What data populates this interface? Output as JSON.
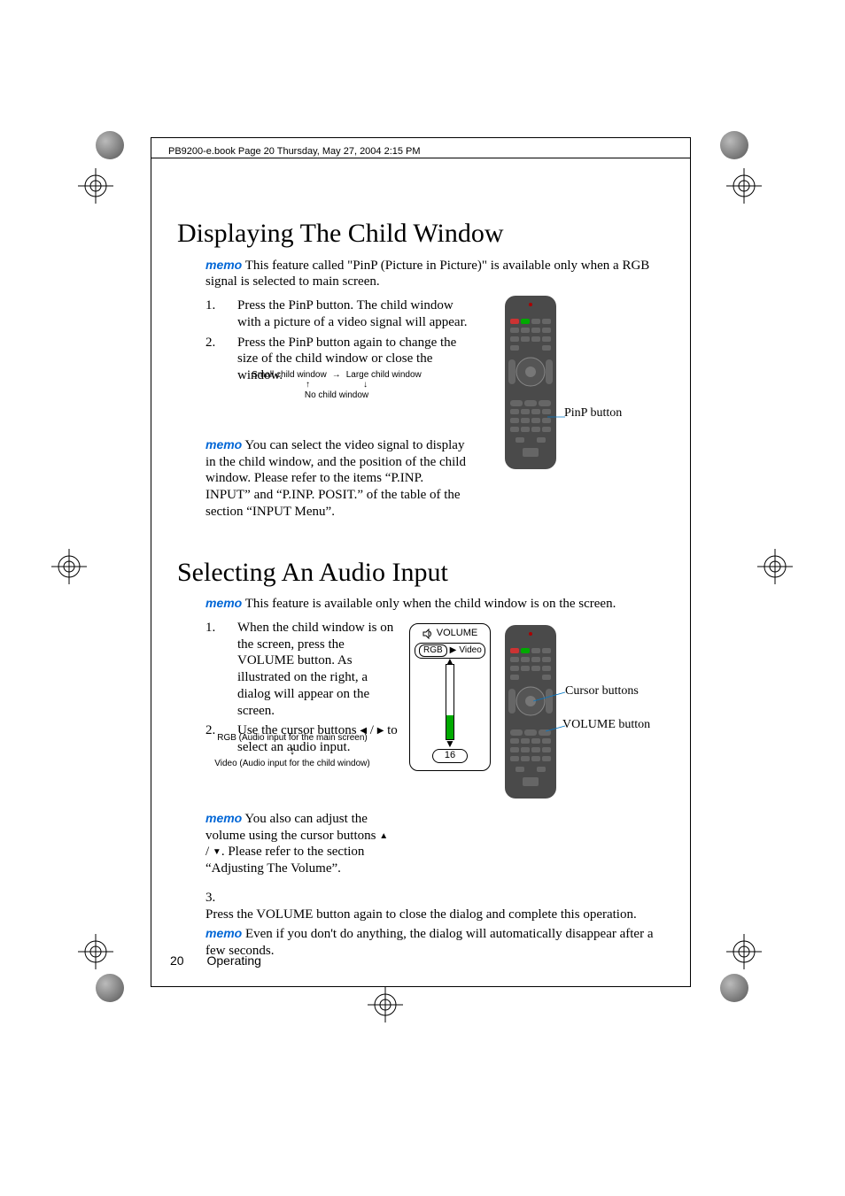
{
  "header": "PB9200-e.book  Page 20  Thursday, May 27, 2004  2:15 PM",
  "section1": {
    "title": "Displaying The Child Window",
    "memo_label": "memo",
    "memo_text": " This feature called \"PinP (Picture in Picture)\" is available only when a RGB signal is selected to main screen.",
    "step1": "Press the PinP button. The child window with a picture of a video signal will appear.",
    "step2": "Press the PinP button again to change the size of the child window or close the window.",
    "diag_small": "Small child window",
    "diag_large": "Large child window",
    "diag_none": "No child window",
    "memo2_text": " You can select the video signal to display in the child window, and the position of the child window. Please refer to the items “P.INP. INPUT” and “P.INP. POSIT.” of the table of the section “INPUT Menu”.",
    "callout": "PinP button"
  },
  "section2": {
    "title": "Selecting An Audio Input",
    "memo_label": "memo",
    "memo_text": " This feature is available only when the child window is on the screen.",
    "step1": "When the child window is on the screen, press the VOLUME button. As illustrated on the right, a dialog will appear on the screen.",
    "step2a": "Use the cursor buttons ",
    "step2b": " to select an audio input.",
    "diag_rgb": "RGB (Audio input for the main screen)",
    "diag_video": "Video (Audio input for the child window)",
    "memo2_text": " You also can adjust the volume using the cursor buttons ",
    "memo2_text2": ". Please refer to the section “Adjusting The Volume”.",
    "step3": "Press the VOLUME button again to close the dialog and complete this operation.",
    "memo3_text": " Even if you don't do anything, the dialog will automatically disappear after a few seconds.",
    "osd_volume": "VOLUME",
    "osd_rgb": "RGB",
    "osd_video": "Video",
    "osd_value": "16",
    "callout_cursor": "Cursor buttons",
    "callout_volume": "VOLUME button"
  },
  "footer": {
    "page": "20",
    "section": "Operating"
  }
}
